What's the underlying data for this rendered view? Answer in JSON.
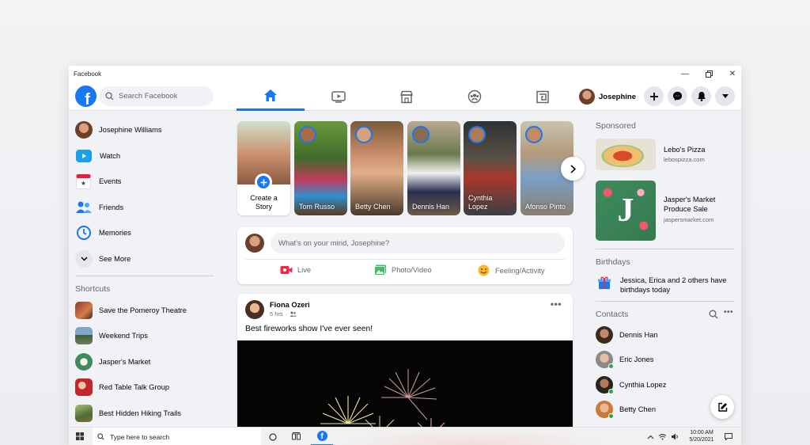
{
  "window": {
    "title": "Facebook"
  },
  "topbar": {
    "search_placeholder": "Search Facebook",
    "profile_name": "Josephine"
  },
  "left_nav": {
    "items": [
      {
        "label": "Josephine Williams",
        "icon": "profile-avatar"
      },
      {
        "label": "Watch",
        "icon": "watch-icon"
      },
      {
        "label": "Events",
        "icon": "calendar-icon"
      },
      {
        "label": "Friends",
        "icon": "friends-icon"
      },
      {
        "label": "Memories",
        "icon": "clock-icon"
      },
      {
        "label": "See More",
        "icon": "chevron-down-icon"
      }
    ],
    "shortcuts_title": "Shortcuts",
    "shortcuts": [
      {
        "label": "Save the Pomeroy Theatre"
      },
      {
        "label": "Weekend Trips"
      },
      {
        "label": "Jasper's Market"
      },
      {
        "label": "Red Table Talk Group"
      },
      {
        "label": "Best Hidden Hiking Trails"
      }
    ]
  },
  "stories": [
    {
      "label": "Create a Story",
      "color": "#c98d6a"
    },
    {
      "label": "Tom Russo",
      "color": "#4f7a2c"
    },
    {
      "label": "Betty Chen",
      "color": "#b0643c"
    },
    {
      "label": "Dennis Han",
      "color": "#7a6e5c"
    },
    {
      "label": "Cynthia Lopez",
      "color": "#3d4549"
    },
    {
      "label": "Afonso Pinto",
      "color": "#9a8d74"
    }
  ],
  "composer": {
    "placeholder": "What's on your mind, Josephine?",
    "actions": [
      {
        "label": "Live",
        "color": "#f02849"
      },
      {
        "label": "Photo/Video",
        "color": "#45bd62"
      },
      {
        "label": "Feeling/Activity",
        "color": "#f7b928"
      }
    ]
  },
  "post": {
    "author": "Fiona Ozeri",
    "time": "5 hrs",
    "text": "Best fireworks show I've ever seen!"
  },
  "sponsored": {
    "title": "Sponsored",
    "ads": [
      {
        "name": "Lebo's Pizza",
        "url": "lebospizza.com"
      },
      {
        "name": "Jasper's Market Produce Sale",
        "url": "jaspersmarket.com"
      }
    ]
  },
  "birthdays": {
    "title": "Birthdays",
    "text": "Jessica, Erica and 2 others have birthdays today"
  },
  "contacts": {
    "title": "Contacts",
    "people": [
      {
        "name": "Dennis Han",
        "online": false
      },
      {
        "name": "Eric Jones",
        "online": true
      },
      {
        "name": "Cynthia Lopez",
        "online": true
      },
      {
        "name": "Betty Chen",
        "online": true
      }
    ]
  },
  "taskbar": {
    "search_placeholder": "Type here to search",
    "time": "10:00 AM",
    "date": "5/20/2021"
  },
  "colors": {
    "brand": "#1877f2",
    "background": "#f0f2f5"
  }
}
